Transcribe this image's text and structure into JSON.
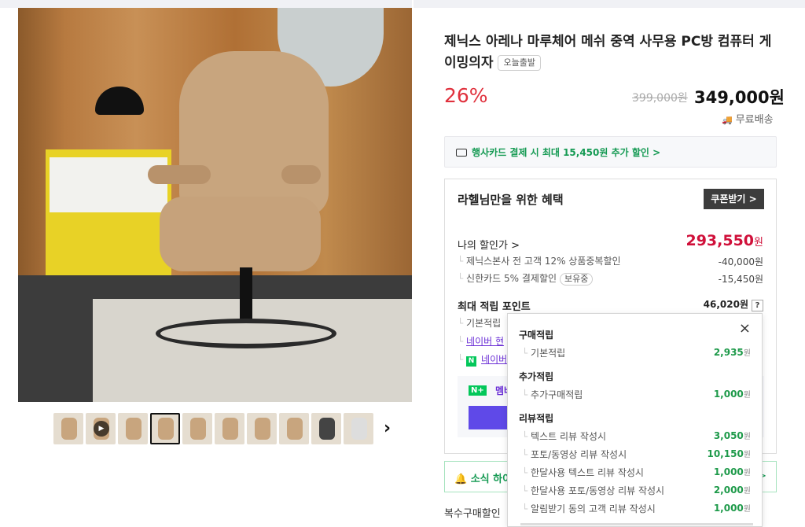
{
  "product": {
    "title": "제닉스 아레나 마루체어 메쉬 중역 사무용 PC방 컴퓨터 게이밍의자",
    "badge_today": "오늘출발",
    "discount_rate": "26%",
    "original_price": "399,000원",
    "sale_price": "349,000원",
    "shipping": "무료배송"
  },
  "gallery": {
    "thumbnails": [
      "thumb-1",
      "thumb-2-video",
      "thumb-3",
      "thumb-4",
      "thumb-5",
      "thumb-6",
      "thumb-7",
      "thumb-8",
      "thumb-9",
      "thumb-10"
    ],
    "active_index": 3,
    "next_icon": "›"
  },
  "card_banner": {
    "text": "행사카드 결제 시 최대 15,450원 추가 할인 >",
    "icon": "credit-card-icon"
  },
  "benefit": {
    "title": "라헬님만을 위한 혜택",
    "coupon_button": "쿠폰받기 >",
    "my_discount_label": "나의 할인가 >",
    "my_discount_value": "293,550",
    "my_discount_unit": "원",
    "discount_items": [
      {
        "label": "제닉스본사 전 고객 12% 상품중복할인",
        "value": "-40,000원"
      },
      {
        "label": "신한카드 5% 결제할인",
        "pill": "보유중",
        "value": "-15,450원"
      }
    ],
    "max_points_label": "최대 적립 포인트",
    "max_points_value": "46,020원",
    "help_icon": "?",
    "point_items": [
      {
        "label": "기본적립"
      },
      {
        "label": "네이버 현"
      },
      {
        "label": "네이버"
      }
    ],
    "npay_text": "멤버"
  },
  "alarm": {
    "text": "소식 하이",
    "arrow": ">"
  },
  "multi_purchase": "복수구매할인",
  "popover": {
    "close": "×",
    "sections": [
      {
        "title": "구매적립",
        "items": [
          {
            "label": "기본적립",
            "value": "2,935",
            "unit": "원"
          }
        ]
      },
      {
        "title": "추가적립",
        "items": [
          {
            "label": "추가구매적립",
            "value": "1,000",
            "unit": "원"
          }
        ]
      },
      {
        "title": "리뷰적립",
        "items": [
          {
            "label": "텍스트 리뷰 작성시",
            "value": "3,050",
            "unit": "원"
          },
          {
            "label": "포토/동영상 리뷰 작성시",
            "value": "10,150",
            "unit": "원"
          },
          {
            "label": "한달사용 텍스트 리뷰 작성시",
            "value": "1,000",
            "unit": "원"
          },
          {
            "label": "한달사용 포토/동영상 리뷰 작성시",
            "value": "2,000",
            "unit": "원"
          },
          {
            "label": "알림받기 동의 고객 리뷰 작성시",
            "value": "1,000",
            "unit": "원"
          }
        ]
      }
    ]
  },
  "colors": {
    "discount_red": "#e0313d",
    "price_red": "#d0103a",
    "naver_green": "#159a53",
    "point_green": "#1e9a4a",
    "npay_purple": "#5f49e8"
  }
}
